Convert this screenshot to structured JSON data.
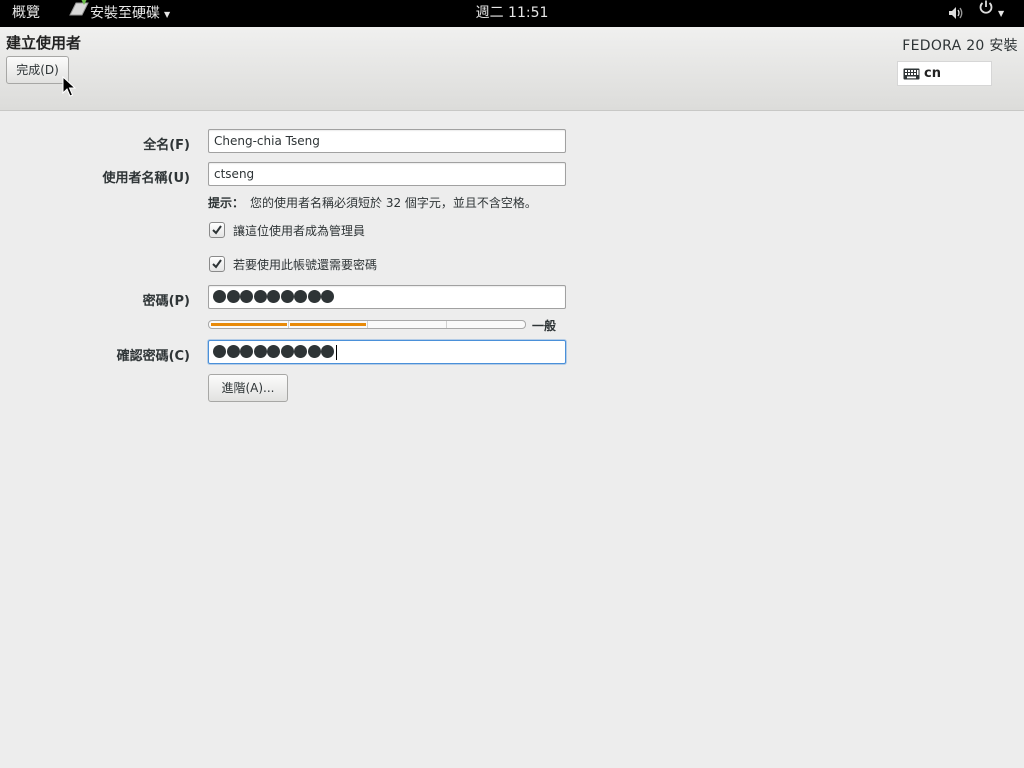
{
  "topbar": {
    "activities": "概覽",
    "app_menu": "安裝至硬碟",
    "clock": "週二 11:51",
    "icons": [
      "volume-icon",
      "power-icon"
    ]
  },
  "header": {
    "title": "建立使用者",
    "done_button": "完成(D)",
    "product": "FEDORA 20 安裝",
    "keyboard_layout": "cn"
  },
  "form": {
    "fullname_label": "全名(F)",
    "fullname_value": "Cheng-chia Tseng",
    "username_label": "使用者名稱(U)",
    "username_value": "ctseng",
    "hint_label": "提示：",
    "hint_text": "您的使用者名稱必須短於 32 個字元，並且不含空格。",
    "admin_checkbox_label": "讓這位使用者成為管理員",
    "admin_checked": true,
    "require_password_label": "若要使用此帳號還需要密碼",
    "require_password_checked": true,
    "password_label": "密碼(P)",
    "password_mask_count": 9,
    "strength_label": "一般",
    "strength_level": 0.5,
    "confirm_label": "確認密碼(C)",
    "confirm_mask_count": 9,
    "advanced_button": "進階(A)..."
  },
  "colors": {
    "strength_fill": "#e88a0a",
    "focus": "#4a90d9"
  }
}
